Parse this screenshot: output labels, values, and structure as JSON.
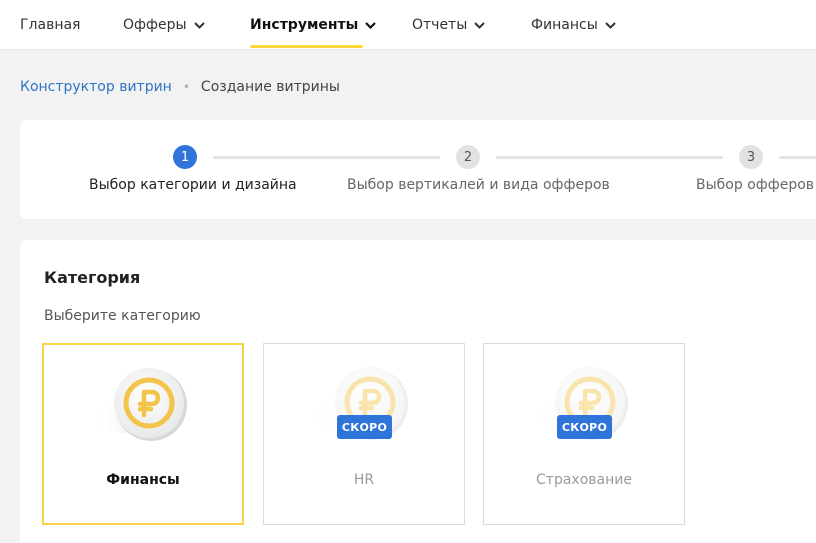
{
  "nav": {
    "items": [
      {
        "label": "Главная",
        "has_dropdown": false,
        "active": false
      },
      {
        "label": "Офферы",
        "has_dropdown": true,
        "active": false
      },
      {
        "label": "Инструменты",
        "has_dropdown": true,
        "active": true
      },
      {
        "label": "Отчеты",
        "has_dropdown": true,
        "active": false
      },
      {
        "label": "Финансы",
        "has_dropdown": true,
        "active": false
      }
    ],
    "accent_color": "#ffd83c"
  },
  "breadcrumb": {
    "link": "Конструктор витрин",
    "separator": "•",
    "current": "Создание витрины"
  },
  "stepper": {
    "steps": [
      {
        "number": "1",
        "label": "Выбор категории и дизайна",
        "active": true
      },
      {
        "number": "2",
        "label": "Выбор вертикалей и вида офферов",
        "active": false
      },
      {
        "number": "3",
        "label": "Выбор офферов",
        "active": false
      }
    ],
    "active_color": "#2f74d8"
  },
  "category": {
    "title": "Категория",
    "subtitle": "Выберите категорию",
    "options": [
      {
        "label": "Финансы",
        "selected": true,
        "badge": "",
        "icon": "ruble-coin-icon"
      },
      {
        "label": "HR",
        "selected": false,
        "badge": "СКОРО",
        "icon": "ruble-coin-icon"
      },
      {
        "label": "Страхование",
        "selected": false,
        "badge": "СКОРО",
        "icon": "ruble-coin-icon"
      }
    ]
  }
}
